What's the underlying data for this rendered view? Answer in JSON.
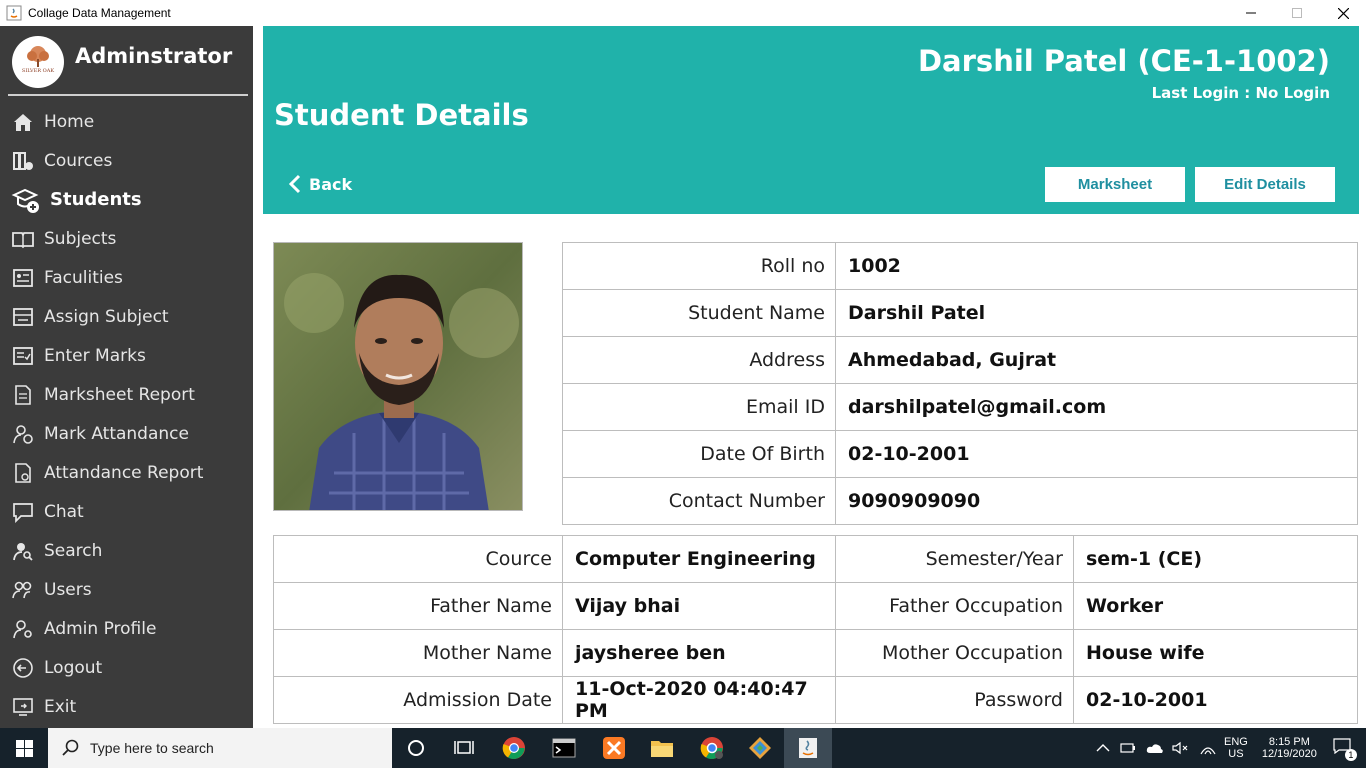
{
  "window": {
    "title": "Collage Data Management"
  },
  "sidebar": {
    "brand": "Adminstrator",
    "logo_text": "SILVER OAK",
    "items": [
      {
        "label": "Home",
        "icon": "home-icon"
      },
      {
        "label": "Cources",
        "icon": "courses-icon"
      },
      {
        "label": "Students",
        "icon": "students-icon",
        "active": true
      },
      {
        "label": "Subjects",
        "icon": "book-icon"
      },
      {
        "label": "Faculities",
        "icon": "faculty-icon"
      },
      {
        "label": "Assign Subject",
        "icon": "assign-icon"
      },
      {
        "label": "Enter Marks",
        "icon": "marks-icon"
      },
      {
        "label": "Marksheet Report",
        "icon": "report-icon"
      },
      {
        "label": "Mark Attandance",
        "icon": "attendance-icon"
      },
      {
        "label": "Attandance Report",
        "icon": "attendance-report-icon"
      },
      {
        "label": "Chat",
        "icon": "chat-icon"
      },
      {
        "label": "Search",
        "icon": "search-user-icon"
      },
      {
        "label": "Users",
        "icon": "users-icon"
      },
      {
        "label": "Admin Profile",
        "icon": "admin-profile-icon"
      },
      {
        "label": "Logout",
        "icon": "logout-icon"
      },
      {
        "label": "Exit",
        "icon": "exit-icon"
      }
    ]
  },
  "header": {
    "student_title": "Darshil Patel (CE-1-1002)",
    "last_login": "Last Login : No Login",
    "page_title": "Student Details",
    "back_label": "Back",
    "marksheet_label": "Marksheet",
    "edit_label": "Edit Details"
  },
  "details": {
    "rows": [
      {
        "label": "Roll no",
        "value": "1002"
      },
      {
        "label": "Student Name",
        "value": "Darshil Patel"
      },
      {
        "label": "Address",
        "value": "Ahmedabad, Gujrat"
      },
      {
        "label": "Email ID",
        "value": "darshilpatel@gmail.com"
      },
      {
        "label": "Date Of Birth",
        "value": "02-10-2001"
      },
      {
        "label": "Contact Number",
        "value": "9090909090"
      }
    ]
  },
  "extra": {
    "rows": [
      {
        "l1": "Cource",
        "v1": "Computer Engineering",
        "l2": "Semester/Year",
        "v2": "sem-1  (CE)"
      },
      {
        "l1": "Father Name",
        "v1": "Vijay bhai",
        "l2": "Father Occupation",
        "v2": "Worker"
      },
      {
        "l1": "Mother Name",
        "v1": "jaysheree ben",
        "l2": "Mother Occupation",
        "v2": "House wife"
      },
      {
        "l1": "Admission Date",
        "v1": "11-Oct-2020 04:40:47 PM",
        "l2": "Password",
        "v2": "02-10-2001"
      }
    ]
  },
  "taskbar": {
    "search_placeholder": "Type here to search",
    "lang_top": "ENG",
    "lang_bottom": "US",
    "time": "8:15 PM",
    "date": "12/19/2020",
    "notif_count": "1"
  }
}
